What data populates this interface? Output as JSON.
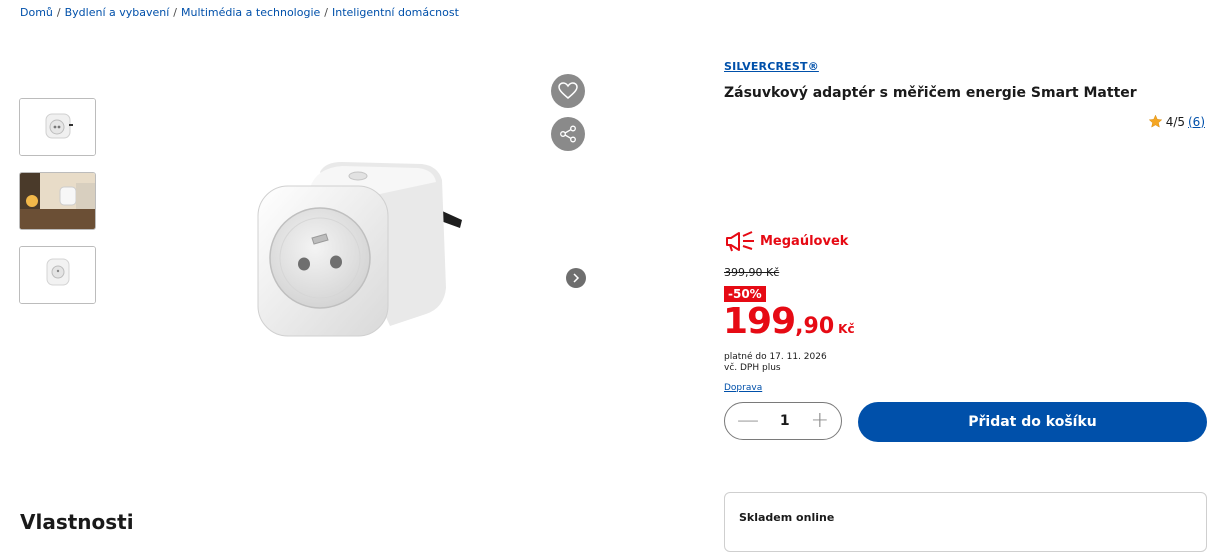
{
  "breadcrumb": {
    "items": [
      "Domů",
      "Bydlení a vybavení",
      "Multimédia a technologie",
      "Inteligentní domácnost"
    ],
    "separator": "/"
  },
  "gallery": {
    "thumbnails": [
      "thumbnail-plug-front",
      "thumbnail-plug-in-room",
      "thumbnail-plug-top"
    ],
    "next_icon": "chevron-right-icon"
  },
  "actions": {
    "favorite_icon": "heart-icon",
    "share_icon": "share-icon"
  },
  "product": {
    "brand": "SILVERCREST®",
    "title": "Zásuvkový adaptér s měřičem energie Smart Matter",
    "rating_text": "4/5",
    "rating_value": 4,
    "rating_max": 5,
    "review_count": "(6)"
  },
  "promo": {
    "label": "Megaúlovek",
    "icon": "megaphone-icon"
  },
  "pricing": {
    "old_price": "399,90 Kč",
    "discount": "-50%",
    "price_int": "199",
    "price_dec": ",90",
    "currency": "Kč",
    "valid_until": "platné do 17. 11. 2026",
    "vat_note": "vč. DPH plus",
    "shipping_link": "Doprava"
  },
  "cart": {
    "quantity": "1",
    "minus": "—",
    "plus": "+",
    "add_label": "Přidat do košíku"
  },
  "sections": {
    "properties_heading": "Vlastnosti",
    "stock_label": "Skladem online"
  },
  "colors": {
    "accent_blue": "#0050aa",
    "promo_red": "#e60a14",
    "star": "#f5a623"
  }
}
